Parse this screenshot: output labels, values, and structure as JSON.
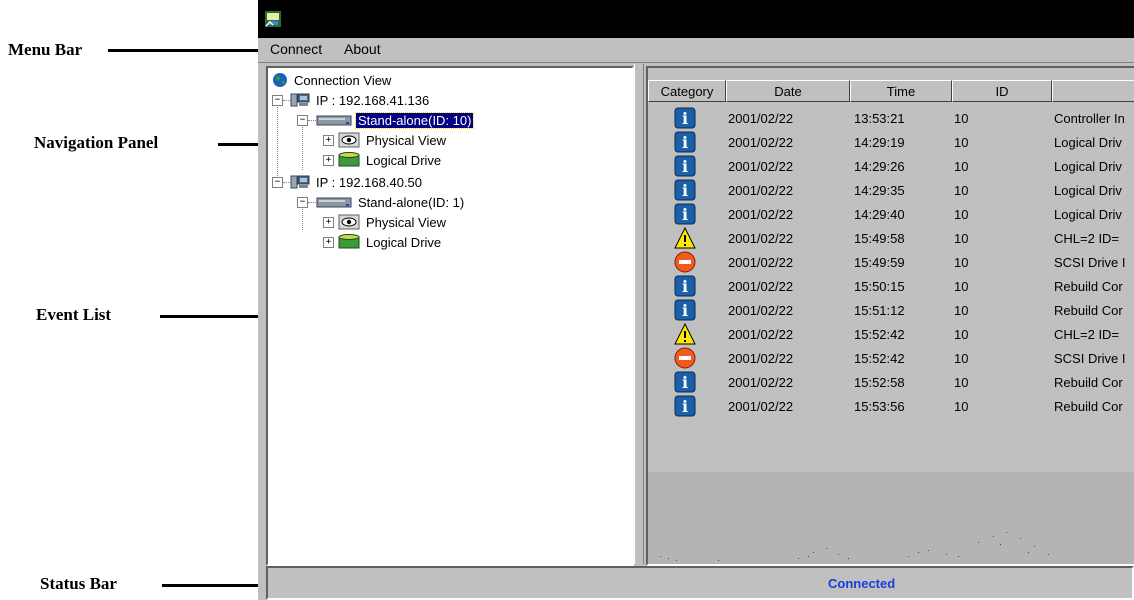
{
  "callouts": {
    "menu_bar": "Menu Bar",
    "navigation_panel": "Navigation Panel",
    "event_list": "Event List",
    "status_bar": "Status Bar"
  },
  "menu": {
    "connect": "Connect",
    "about": "About"
  },
  "tree": {
    "root": "Connection View",
    "hosts": [
      {
        "ip": "IP : 192.168.41.136",
        "controller": "Stand-alone(ID: 10)",
        "selected": true,
        "children": [
          "Physical View",
          "Logical Drive"
        ]
      },
      {
        "ip": "IP : 192.168.40.50",
        "controller": "Stand-alone(ID: 1)",
        "selected": false,
        "children": [
          "Physical View",
          "Logical Drive"
        ]
      }
    ]
  },
  "events": {
    "columns": [
      "Category",
      "Date",
      "Time",
      "ID",
      ""
    ],
    "rows": [
      {
        "category": "info",
        "date": "2001/02/22",
        "time": "13:53:21",
        "id": "10",
        "text": "Controller In"
      },
      {
        "category": "info",
        "date": "2001/02/22",
        "time": "14:29:19",
        "id": "10",
        "text": "Logical Driv"
      },
      {
        "category": "info",
        "date": "2001/02/22",
        "time": "14:29:26",
        "id": "10",
        "text": "Logical Driv"
      },
      {
        "category": "info",
        "date": "2001/02/22",
        "time": "14:29:35",
        "id": "10",
        "text": "Logical Driv"
      },
      {
        "category": "info",
        "date": "2001/02/22",
        "time": "14:29:40",
        "id": "10",
        "text": "Logical Driv"
      },
      {
        "category": "warning",
        "date": "2001/02/22",
        "time": "15:49:58",
        "id": "10",
        "text": "CHL=2 ID="
      },
      {
        "category": "error",
        "date": "2001/02/22",
        "time": "15:49:59",
        "id": "10",
        "text": "SCSI Drive I"
      },
      {
        "category": "info",
        "date": "2001/02/22",
        "time": "15:50:15",
        "id": "10",
        "text": "Rebuild Cor"
      },
      {
        "category": "info",
        "date": "2001/02/22",
        "time": "15:51:12",
        "id": "10",
        "text": "Rebuild Cor"
      },
      {
        "category": "warning",
        "date": "2001/02/22",
        "time": "15:52:42",
        "id": "10",
        "text": "CHL=2 ID="
      },
      {
        "category": "error",
        "date": "2001/02/22",
        "time": "15:52:42",
        "id": "10",
        "text": "SCSI Drive I"
      },
      {
        "category": "info",
        "date": "2001/02/22",
        "time": "15:52:58",
        "id": "10",
        "text": "Rebuild Cor"
      },
      {
        "category": "info",
        "date": "2001/02/22",
        "time": "15:53:56",
        "id": "10",
        "text": "Rebuild Cor"
      }
    ]
  },
  "status": {
    "text": "Connected",
    "color": "#1e3cd8"
  },
  "colors": {
    "info": "#1a5fa8",
    "warning": "#ffe800",
    "error": "#f05a1e",
    "selection": "#000080"
  },
  "icons": {
    "app": "app-icon",
    "globe": "globe-icon",
    "host": "computer-icon",
    "controller": "controller-icon",
    "physical": "eye-icon",
    "logical": "drive-icon",
    "info": "info-icon",
    "warning": "warning-icon",
    "error": "error-icon"
  }
}
